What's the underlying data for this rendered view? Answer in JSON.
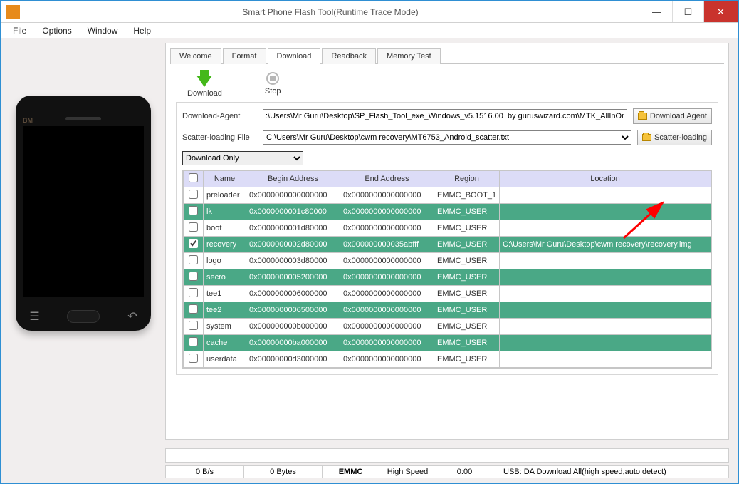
{
  "window": {
    "title": "Smart Phone Flash Tool(Runtime Trace Mode)"
  },
  "menu": {
    "file": "File",
    "options": "Options",
    "window": "Window",
    "help": "Help"
  },
  "phone": {
    "brand": "BM"
  },
  "tabs": {
    "welcome": "Welcome",
    "format": "Format",
    "download": "Download",
    "readback": "Readback",
    "memtest": "Memory Test"
  },
  "toolbar": {
    "download": "Download",
    "stop": "Stop"
  },
  "form": {
    "da_label": "Download-Agent",
    "da_value": ":\\Users\\Mr Guru\\Desktop\\SP_Flash_Tool_exe_Windows_v5.1516.00  by guruswizard.com\\MTK_AllInOne_DA.bin",
    "da_btn": "Download Agent",
    "scatter_label": "Scatter-loading File",
    "scatter_value": "C:\\Users\\Mr Guru\\Desktop\\cwm recovery\\MT6753_Android_scatter.txt",
    "scatter_btn": "Scatter-loading",
    "mode": "Download Only"
  },
  "grid": {
    "headers": {
      "name": "Name",
      "begin": "Begin Address",
      "end": "End Address",
      "region": "Region",
      "location": "Location"
    },
    "rows": [
      {
        "checked": false,
        "green": false,
        "name": "preloader",
        "begin": "0x0000000000000000",
        "end": "0x0000000000000000",
        "region": "EMMC_BOOT_1",
        "location": ""
      },
      {
        "checked": false,
        "green": true,
        "name": "lk",
        "begin": "0x0000000001c80000",
        "end": "0x0000000000000000",
        "region": "EMMC_USER",
        "location": ""
      },
      {
        "checked": false,
        "green": false,
        "name": "boot",
        "begin": "0x0000000001d80000",
        "end": "0x0000000000000000",
        "region": "EMMC_USER",
        "location": ""
      },
      {
        "checked": true,
        "green": true,
        "name": "recovery",
        "begin": "0x0000000002d80000",
        "end": "0x000000000035abfff",
        "region": "EMMC_USER",
        "location": "C:\\Users\\Mr Guru\\Desktop\\cwm recovery\\recovery.img"
      },
      {
        "checked": false,
        "green": false,
        "name": "logo",
        "begin": "0x0000000003d80000",
        "end": "0x0000000000000000",
        "region": "EMMC_USER",
        "location": ""
      },
      {
        "checked": false,
        "green": true,
        "name": "secro",
        "begin": "0x0000000005200000",
        "end": "0x0000000000000000",
        "region": "EMMC_USER",
        "location": ""
      },
      {
        "checked": false,
        "green": false,
        "name": "tee1",
        "begin": "0x0000000006000000",
        "end": "0x0000000000000000",
        "region": "EMMC_USER",
        "location": ""
      },
      {
        "checked": false,
        "green": true,
        "name": "tee2",
        "begin": "0x0000000006500000",
        "end": "0x0000000000000000",
        "region": "EMMC_USER",
        "location": ""
      },
      {
        "checked": false,
        "green": false,
        "name": "system",
        "begin": "0x000000000b000000",
        "end": "0x0000000000000000",
        "region": "EMMC_USER",
        "location": ""
      },
      {
        "checked": false,
        "green": true,
        "name": "cache",
        "begin": "0x00000000ba000000",
        "end": "0x0000000000000000",
        "region": "EMMC_USER",
        "location": ""
      },
      {
        "checked": false,
        "green": false,
        "name": "userdata",
        "begin": "0x00000000d3000000",
        "end": "0x0000000000000000",
        "region": "EMMC_USER",
        "location": ""
      }
    ]
  },
  "status": {
    "speed": "0 B/s",
    "bytes": "0 Bytes",
    "storage": "EMMC",
    "hs": "High Speed",
    "time": "0:00",
    "usb": "USB: DA Download All(high speed,auto detect)"
  }
}
